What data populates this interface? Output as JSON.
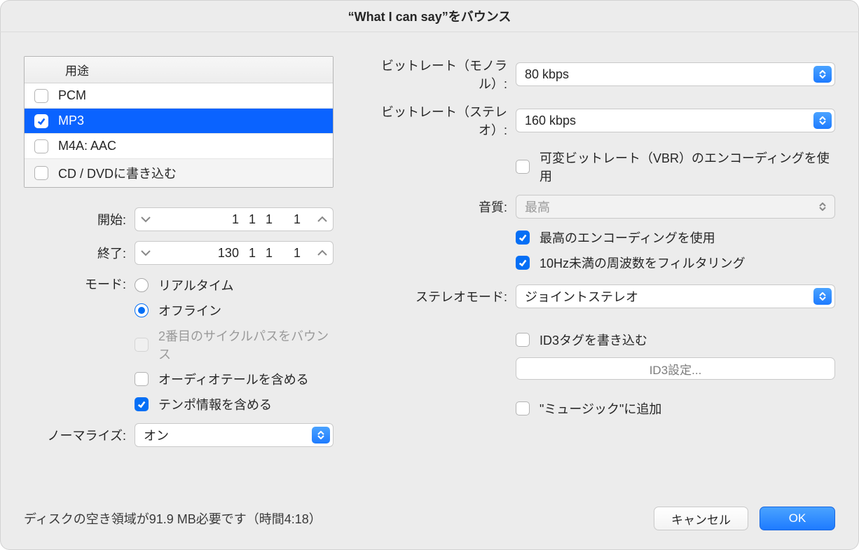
{
  "window": {
    "title": "“What I can say”をバウンス"
  },
  "format_table": {
    "header": "用途",
    "rows": [
      {
        "label": "PCM",
        "checked": false
      },
      {
        "label": "MP3",
        "checked": true,
        "selected": true
      },
      {
        "label": "M4A: AAC",
        "checked": false
      },
      {
        "label": "CD / DVDに書き込む",
        "checked": false
      }
    ]
  },
  "start": {
    "label": "開始:",
    "values": [
      "1",
      "1",
      "1",
      "1"
    ]
  },
  "end": {
    "label": "終了:",
    "values": [
      "130",
      "1",
      "1",
      "1"
    ]
  },
  "mode": {
    "label": "モード:",
    "options": {
      "realtime": "リアルタイム",
      "offline": "オフライン"
    },
    "selected": "offline",
    "second_pass": {
      "label": "2番目のサイクルパスをバウンス",
      "enabled": false
    },
    "include_tail": {
      "label": "オーディオテールを含める",
      "checked": false
    },
    "include_tempo": {
      "label": "テンポ情報を含める",
      "checked": true
    }
  },
  "normalize": {
    "label": "ノーマライズ:",
    "value": "オン"
  },
  "bitrate_mono": {
    "label": "ビットレート（モノラル）:",
    "value": "80 kbps"
  },
  "bitrate_stereo": {
    "label": "ビットレート（ステレオ）:",
    "value": "160 kbps"
  },
  "vbr": {
    "label": "可変ビットレート（VBR）のエンコーディングを使用",
    "checked": false
  },
  "quality": {
    "label": "音質:",
    "value": "最高",
    "enabled": false
  },
  "best_encoding": {
    "label": "最高のエンコーディングを使用",
    "checked": true
  },
  "filter_10hz": {
    "label": "10Hz未満の周波数をフィルタリング",
    "checked": true
  },
  "stereo_mode": {
    "label": "ステレオモード:",
    "value": "ジョイントステレオ"
  },
  "write_id3": {
    "label": "ID3タグを書き込む",
    "checked": false
  },
  "id3_settings_button": "ID3設定...",
  "add_to_music": {
    "label": "\"ミュージック\"に追加",
    "checked": false
  },
  "status": "ディスクの空き領域が91.9 MB必要です（時間4:18）",
  "buttons": {
    "cancel": "キャンセル",
    "ok": "OK"
  }
}
